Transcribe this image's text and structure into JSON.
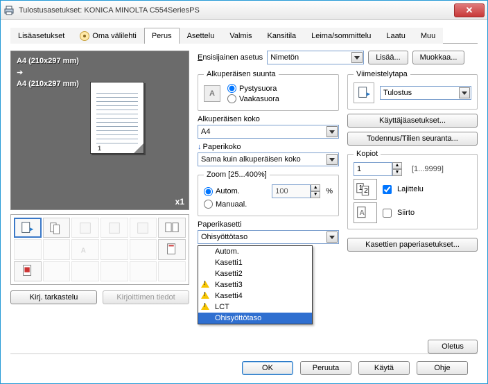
{
  "window": {
    "title": "Tulostusasetukset: KONICA MINOLTA C554SeriesPS"
  },
  "tabs": [
    "Lisäasetukset",
    "Oma välilehti",
    "Perus",
    "Asettelu",
    "Valmis",
    "Kansitila",
    "Leima/sommittelu",
    "Laatu",
    "Muu"
  ],
  "active_tab": 2,
  "favorite": {
    "label": "Ensisijainen asetus",
    "value": "Nimetön",
    "add": "Lisää...",
    "edit": "Muokkaa..."
  },
  "preview": {
    "size_from": "A4 (210x297 mm)",
    "size_to": "A4 (210x297 mm)",
    "multiplier": "x1"
  },
  "left_buttons": {
    "view": "Kirj. tarkastelu",
    "printer_info": "Kirjoittimen tiedot"
  },
  "orientation": {
    "legend": "Alkuperäisen suunta",
    "portrait": "Pystysuora",
    "landscape": "Vaakasuora",
    "selected": "portrait"
  },
  "orig_size": {
    "label": "Alkuperäisen koko",
    "value": "A4"
  },
  "paper_size": {
    "label": "Paperikoko",
    "value": "Sama kuin alkuperäisen koko"
  },
  "zoom": {
    "legend": "Zoom [25...400%]",
    "auto": "Autom.",
    "manual": "Manuaal.",
    "value": "100",
    "pct": "%",
    "selected": "auto"
  },
  "tray": {
    "label": "Paperikasetti",
    "value": "Ohisyöttötaso",
    "options": [
      "Autom.",
      "Kasetti1",
      "Kasetti2",
      "Kasetti3",
      "Kasetti4",
      "LCT",
      "Ohisyöttötaso"
    ],
    "warn_indices": [
      3,
      4,
      5
    ],
    "selected_index": 6
  },
  "finishing": {
    "legend": "Viimeistelytapa",
    "value": "Tulostus"
  },
  "right_buttons": {
    "user": "Käyttäjäasetukset...",
    "auth": "Todennus/Tilien seuranta..."
  },
  "copies": {
    "label": "Kopiot",
    "value": "1",
    "range": "[1...9999]",
    "collate": "Lajittelu",
    "offset": "Siirto",
    "collate_checked": true,
    "offset_checked": false
  },
  "tray_settings_btn": "Kasettien paperiasetukset...",
  "defaults_btn": "Oletus",
  "footer": {
    "ok": "OK",
    "cancel": "Peruuta",
    "apply": "Käytä",
    "help": "Ohje"
  }
}
